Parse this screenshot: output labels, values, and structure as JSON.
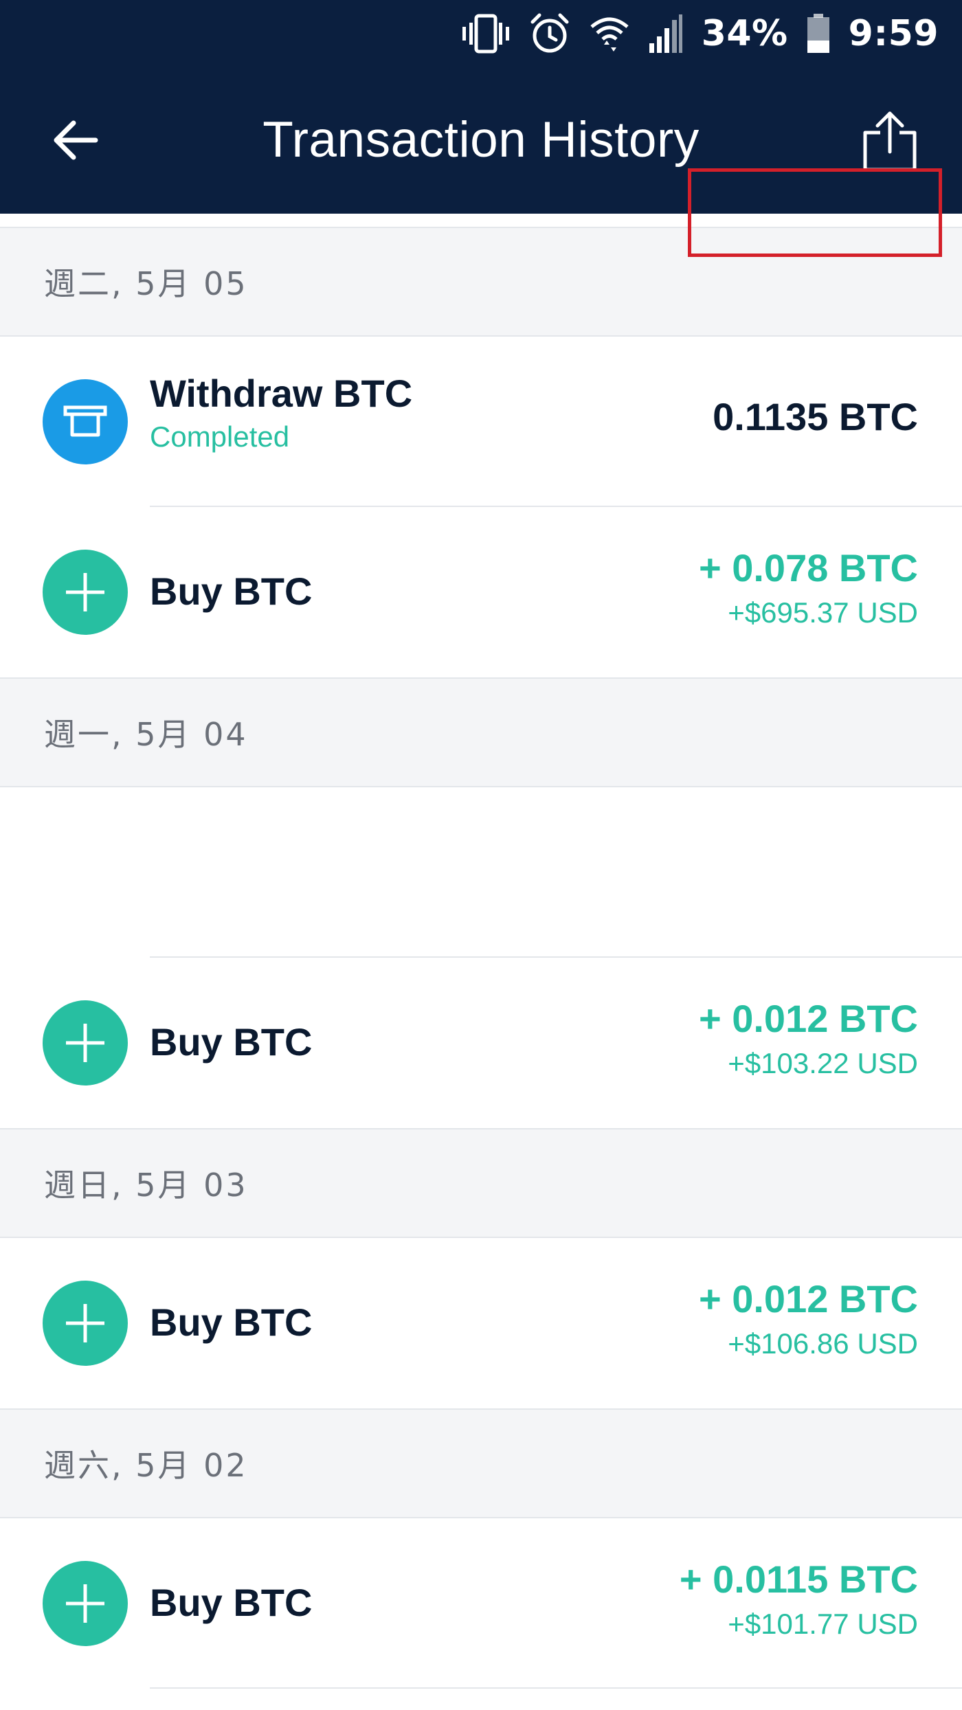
{
  "status_bar": {
    "battery_percent": "34%",
    "time": "9:59",
    "icons": [
      "vibrate-icon",
      "alarm-icon",
      "wifi-icon",
      "signal-icon",
      "battery-icon"
    ]
  },
  "app_bar": {
    "title": "Transaction History",
    "back_icon": "back-arrow-icon",
    "share_icon": "share-icon"
  },
  "colors": {
    "header_bg": "#0b1f3f",
    "accent_green": "#27bfa1",
    "withdraw_blue": "#1a9be6",
    "highlight_red": "#d4202a",
    "section_bg": "#f4f5f7"
  },
  "groups": [
    {
      "date": "週二, 5月 05",
      "transactions": [
        {
          "type": "withdraw",
          "icon": "atm-withdraw-icon",
          "title": "Withdraw BTC",
          "status": "Completed",
          "amount": "0.1135 BTC",
          "highlighted": true
        },
        {
          "type": "buy",
          "icon": "plus-icon",
          "title": "Buy BTC",
          "amount": "+ 0.078 BTC",
          "fiat": "+$695.37 USD"
        }
      ]
    },
    {
      "date": "週一, 5月 04",
      "transactions": [
        {
          "type": "blank"
        },
        {
          "type": "buy",
          "icon": "plus-icon",
          "title": "Buy BTC",
          "amount": "+ 0.012 BTC",
          "fiat": "+$103.22 USD"
        }
      ]
    },
    {
      "date": "週日, 5月 03",
      "transactions": [
        {
          "type": "buy",
          "icon": "plus-icon",
          "title": "Buy BTC",
          "amount": "+ 0.012 BTC",
          "fiat": "+$106.86 USD"
        }
      ]
    },
    {
      "date": "週六, 5月 02",
      "transactions": [
        {
          "type": "buy",
          "icon": "plus-icon",
          "title": "Buy BTC",
          "amount": "+ 0.0115 BTC",
          "fiat": "+$101.77 USD"
        }
      ]
    }
  ]
}
